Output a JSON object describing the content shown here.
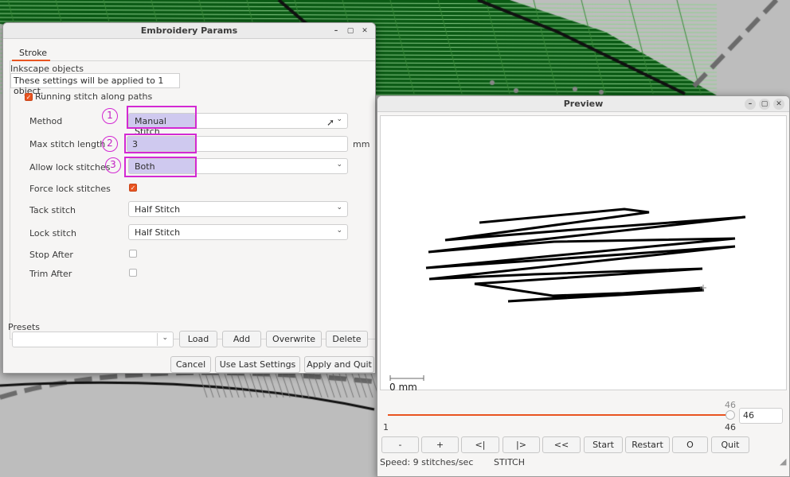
{
  "params_window": {
    "title": "Embroidery Params",
    "tab": "Stroke",
    "section_title": "Inkscape objects",
    "notice": "These settings will be applied to 1 object.",
    "running_stitch_label": "Running stitch along paths",
    "fields": {
      "method": {
        "label": "Method",
        "value": "Manual Stitch",
        "badge": "1"
      },
      "max_stitch_length": {
        "label": "Max stitch length",
        "value": "3",
        "unit": "mm",
        "badge": "2"
      },
      "allow_lock_stitches": {
        "label": "Allow lock stitches",
        "value": "Both",
        "badge": "3"
      },
      "force_lock_stitches": {
        "label": "Force lock stitches",
        "checked": true
      },
      "tack_stitch": {
        "label": "Tack stitch",
        "value": "Half Stitch"
      },
      "lock_stitch": {
        "label": "Lock stitch",
        "value": "Half Stitch"
      },
      "stop_after": {
        "label": "Stop After",
        "checked": false
      },
      "trim_after": {
        "label": "Trim After",
        "checked": false
      }
    },
    "presets": {
      "label": "Presets",
      "value": "",
      "load": "Load",
      "add": "Add",
      "overwrite": "Overwrite",
      "delete": "Delete"
    },
    "footer": {
      "cancel": "Cancel",
      "use_last": "Use Last Settings",
      "apply_quit": "Apply and Quit"
    }
  },
  "preview_window": {
    "title": "Preview",
    "scale_label": "0 mm",
    "slider": {
      "min": "1",
      "max_top": "46",
      "max_bottom": "46",
      "value": "46",
      "fraction": 1.0
    },
    "buttons": [
      "-",
      "+",
      "<|",
      "|>",
      "<<",
      "Start",
      "Restart",
      "O",
      "Quit"
    ],
    "speed": "Speed: 9 stitches/sec",
    "command": "STITCH"
  },
  "window_controls": {
    "minimize": "–",
    "maximize": "▢",
    "close": "✕"
  },
  "colors": {
    "accent": "#e95420",
    "highlight": "#d329d3",
    "fill_green": "#0a5a14"
  }
}
